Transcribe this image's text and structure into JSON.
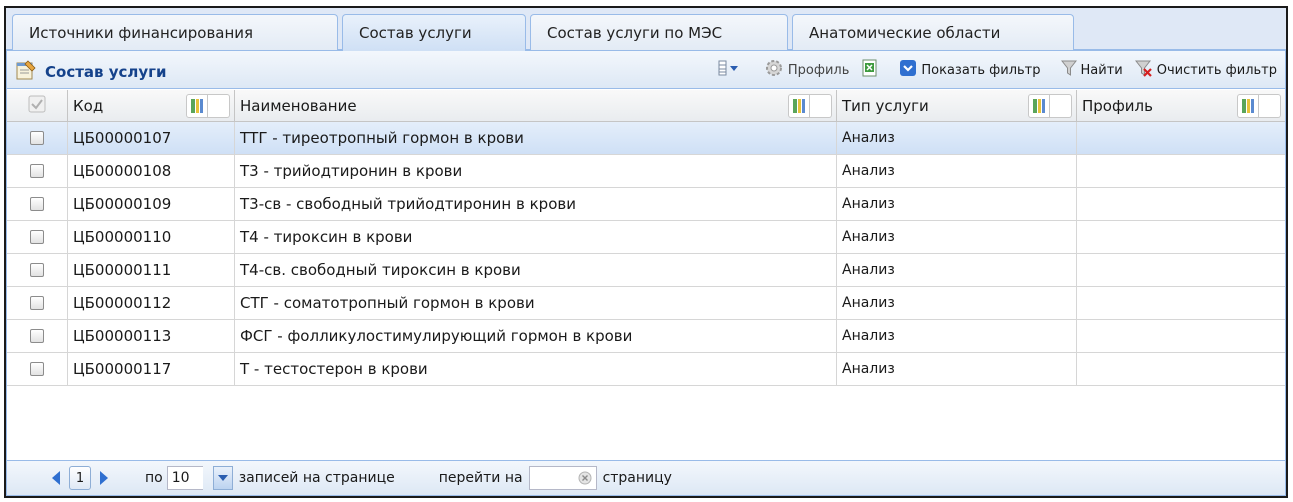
{
  "tabs": [
    {
      "label": "Источники финансирования",
      "active": false
    },
    {
      "label": "Состав услуги",
      "active": true
    },
    {
      "label": "Состав услуги по МЭС",
      "active": false
    },
    {
      "label": "Анатомические области",
      "active": false
    }
  ],
  "panel": {
    "title": "Состав услуги",
    "toolbar": {
      "profile_label": "Профиль",
      "show_filter_label": "Показать фильтр",
      "find_label": "Найти",
      "clear_filter_label": "Очистить фильтр"
    }
  },
  "grid": {
    "columns": [
      "Код",
      "Наименование",
      "Тип услуги",
      "Профиль"
    ],
    "rows": [
      {
        "code": "ЦБ00000107",
        "name": "ТТГ - тиреотропный гормон в крови",
        "type": "Анализ",
        "profile": ""
      },
      {
        "code": "ЦБ00000108",
        "name": "Т3 - трийодтиронин в крови",
        "type": "Анализ",
        "profile": ""
      },
      {
        "code": "ЦБ00000109",
        "name": "Т3-св - свободный трийодтиронин в крови",
        "type": "Анализ",
        "profile": ""
      },
      {
        "code": "ЦБ00000110",
        "name": "Т4 - тироксин в крови",
        "type": "Анализ",
        "profile": ""
      },
      {
        "code": "ЦБ00000111",
        "name": "Т4-св. свободный тироксин в крови",
        "type": "Анализ",
        "profile": ""
      },
      {
        "code": "ЦБ00000112",
        "name": "СТГ - соматотропный гормон в крови",
        "type": "Анализ",
        "profile": ""
      },
      {
        "code": "ЦБ00000113",
        "name": "ФСГ - фолликулостимулирующий гормон в крови",
        "type": "Анализ",
        "profile": ""
      },
      {
        "code": "ЦБ00000117",
        "name": "Т - тестостерон в крови",
        "type": "Анализ",
        "profile": ""
      }
    ]
  },
  "pager": {
    "current_page": "1",
    "per_label": "по",
    "page_size": "10",
    "records_label": "записей на странице",
    "goto_label": "перейти на",
    "goto_value": "",
    "page_label": "страницу"
  },
  "colors": {
    "accent": "#15428b",
    "tab_border": "#99bbe8",
    "selected_row": "#d6e5f7"
  }
}
